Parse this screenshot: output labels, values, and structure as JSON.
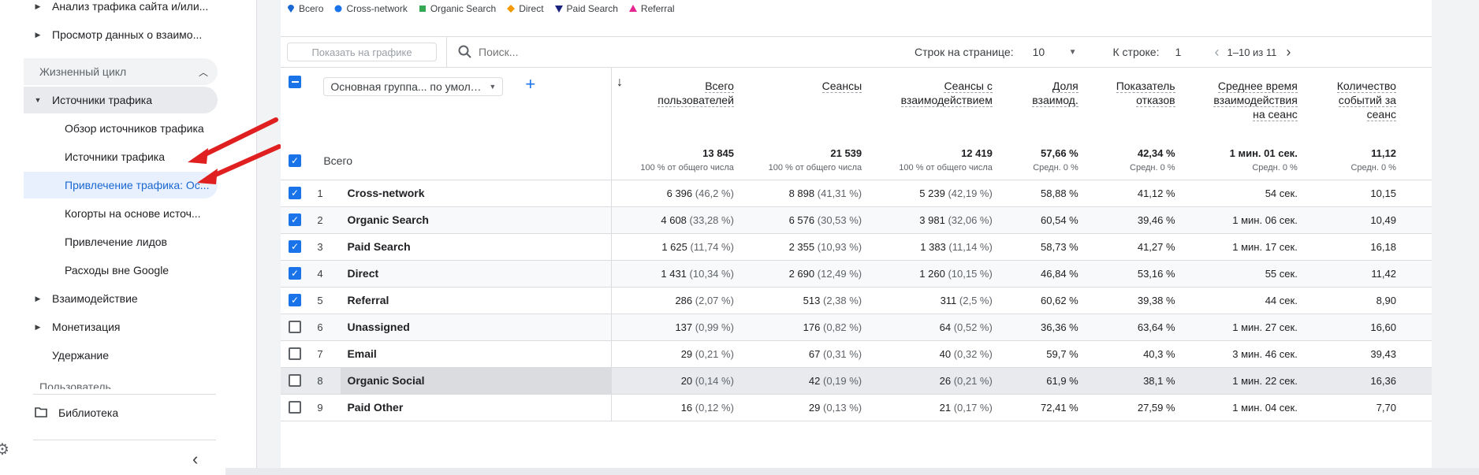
{
  "sidebar": {
    "items_top": [
      {
        "label": "Анализ трафика сайта и/или..."
      },
      {
        "label": "Просмотр данных о взаимо..."
      }
    ],
    "lifecycle_section": "Жизненный цикл",
    "acquisition_parent": "Источники трафика",
    "acquisition_children": [
      {
        "label": "Обзор источников трафика"
      },
      {
        "label": "Источники трафика"
      },
      {
        "label": "Привлечение трафика: Ос..."
      },
      {
        "label": "Когорты на основе источ..."
      },
      {
        "label": "Привлечение лидов"
      },
      {
        "label": "Расходы вне Google"
      }
    ],
    "items_bottom": [
      {
        "label": "Взаимодействие"
      },
      {
        "label": "Монетизация"
      },
      {
        "label": "Удержание"
      }
    ],
    "user_section": "Пользователь",
    "library": "Библиотека"
  },
  "legend": [
    {
      "label": "Всего",
      "color": "#1967d2",
      "shape": "pin"
    },
    {
      "label": "Cross-network",
      "color": "#1a73e8",
      "shape": "circle"
    },
    {
      "label": "Organic Search",
      "color": "#34a853",
      "shape": "square"
    },
    {
      "label": "Direct",
      "color": "#f29900",
      "shape": "diamond"
    },
    {
      "label": "Paid Search",
      "color": "#1a237e",
      "shape": "triangle-down"
    },
    {
      "label": "Referral",
      "color": "#e52592",
      "shape": "triangle-up"
    }
  ],
  "toolbar": {
    "show_on_chart": "Показать на графике",
    "search_placeholder": "Поиск...",
    "rows_per_page_label": "Строк на странице:",
    "rows_per_page_value": "10",
    "go_to_row_label": "К строке:",
    "go_to_row_value": "1",
    "pagination": "1–10 из 11"
  },
  "table": {
    "dimension_select": "Основная группа... по умолчанию)",
    "headers": [
      {
        "l1": "Всего",
        "l2": "пользователей"
      },
      {
        "l1": "Сеансы",
        "l2": ""
      },
      {
        "l1": "Сеансы с",
        "l2": "взаимодействием"
      },
      {
        "l1": "Доля",
        "l2": "взаимод."
      },
      {
        "l1": "Показатель",
        "l2": "отказов"
      },
      {
        "l1": "Среднее время",
        "l2": "взаимодействия",
        "l3": "на сеанс"
      },
      {
        "l1": "Количество",
        "l2": "событий за",
        "l3": "сеанс"
      }
    ],
    "total_label": "Всего",
    "totals": [
      {
        "value": "13 845",
        "sub": "100 % от общего числа"
      },
      {
        "value": "21 539",
        "sub": "100 % от общего числа"
      },
      {
        "value": "12 419",
        "sub": "100 % от общего числа"
      },
      {
        "value": "57,66 %",
        "sub": "Средн. 0 %"
      },
      {
        "value": "42,34 %",
        "sub": "Средн. 0 %"
      },
      {
        "value": "1 мин. 01 сек.",
        "sub": "Средн. 0 %"
      },
      {
        "value": "11,12",
        "sub": "Средн. 0 %"
      }
    ],
    "rows": [
      {
        "n": "1",
        "name": "Cross-network",
        "checked": true,
        "users": "6 396",
        "users_pct": "(46,2 %)",
        "sessions": "8 898",
        "sessions_pct": "(41,31 %)",
        "eng": "5 239",
        "eng_pct": "(42,19 %)",
        "rate": "58,88 %",
        "bounce": "41,12 %",
        "avg": "54 сек.",
        "events": "10,15"
      },
      {
        "n": "2",
        "name": "Organic Search",
        "checked": true,
        "users": "4 608",
        "users_pct": "(33,28 %)",
        "sessions": "6 576",
        "sessions_pct": "(30,53 %)",
        "eng": "3 981",
        "eng_pct": "(32,06 %)",
        "rate": "60,54 %",
        "bounce": "39,46 %",
        "avg": "1 мин. 06 сек.",
        "events": "10,49"
      },
      {
        "n": "3",
        "name": "Paid Search",
        "checked": true,
        "users": "1 625",
        "users_pct": "(11,74 %)",
        "sessions": "2 355",
        "sessions_pct": "(10,93 %)",
        "eng": "1 383",
        "eng_pct": "(11,14 %)",
        "rate": "58,73 %",
        "bounce": "41,27 %",
        "avg": "1 мин. 17 сек.",
        "events": "16,18"
      },
      {
        "n": "4",
        "name": "Direct",
        "checked": true,
        "users": "1 431",
        "users_pct": "(10,34 %)",
        "sessions": "2 690",
        "sessions_pct": "(12,49 %)",
        "eng": "1 260",
        "eng_pct": "(10,15 %)",
        "rate": "46,84 %",
        "bounce": "53,16 %",
        "avg": "55 сек.",
        "events": "11,42"
      },
      {
        "n": "5",
        "name": "Referral",
        "checked": true,
        "users": "286",
        "users_pct": "(2,07 %)",
        "sessions": "513",
        "sessions_pct": "(2,38 %)",
        "eng": "311",
        "eng_pct": "(2,5 %)",
        "rate": "60,62 %",
        "bounce": "39,38 %",
        "avg": "44 сек.",
        "events": "8,90"
      },
      {
        "n": "6",
        "name": "Unassigned",
        "checked": false,
        "users": "137",
        "users_pct": "(0,99 %)",
        "sessions": "176",
        "sessions_pct": "(0,82 %)",
        "eng": "64",
        "eng_pct": "(0,52 %)",
        "rate": "36,36 %",
        "bounce": "63,64 %",
        "avg": "1 мин. 27 сек.",
        "events": "16,60"
      },
      {
        "n": "7",
        "name": "Email",
        "checked": false,
        "users": "29",
        "users_pct": "(0,21 %)",
        "sessions": "67",
        "sessions_pct": "(0,31 %)",
        "eng": "40",
        "eng_pct": "(0,32 %)",
        "rate": "59,7 %",
        "bounce": "40,3 %",
        "avg": "3 мин. 46 сек.",
        "events": "39,43"
      },
      {
        "n": "8",
        "name": "Organic Social",
        "checked": false,
        "users": "20",
        "users_pct": "(0,14 %)",
        "sessions": "42",
        "sessions_pct": "(0,19 %)",
        "eng": "26",
        "eng_pct": "(0,21 %)",
        "rate": "61,9 %",
        "bounce": "38,1 %",
        "avg": "1 мин. 22 сек.",
        "events": "16,36"
      },
      {
        "n": "9",
        "name": "Paid Other",
        "checked": false,
        "users": "16",
        "users_pct": "(0,12 %)",
        "sessions": "29",
        "sessions_pct": "(0,13 %)",
        "eng": "21",
        "eng_pct": "(0,17 %)",
        "rate": "72,41 %",
        "bounce": "27,59 %",
        "avg": "1 мин. 04 сек.",
        "events": "7,70"
      }
    ]
  }
}
